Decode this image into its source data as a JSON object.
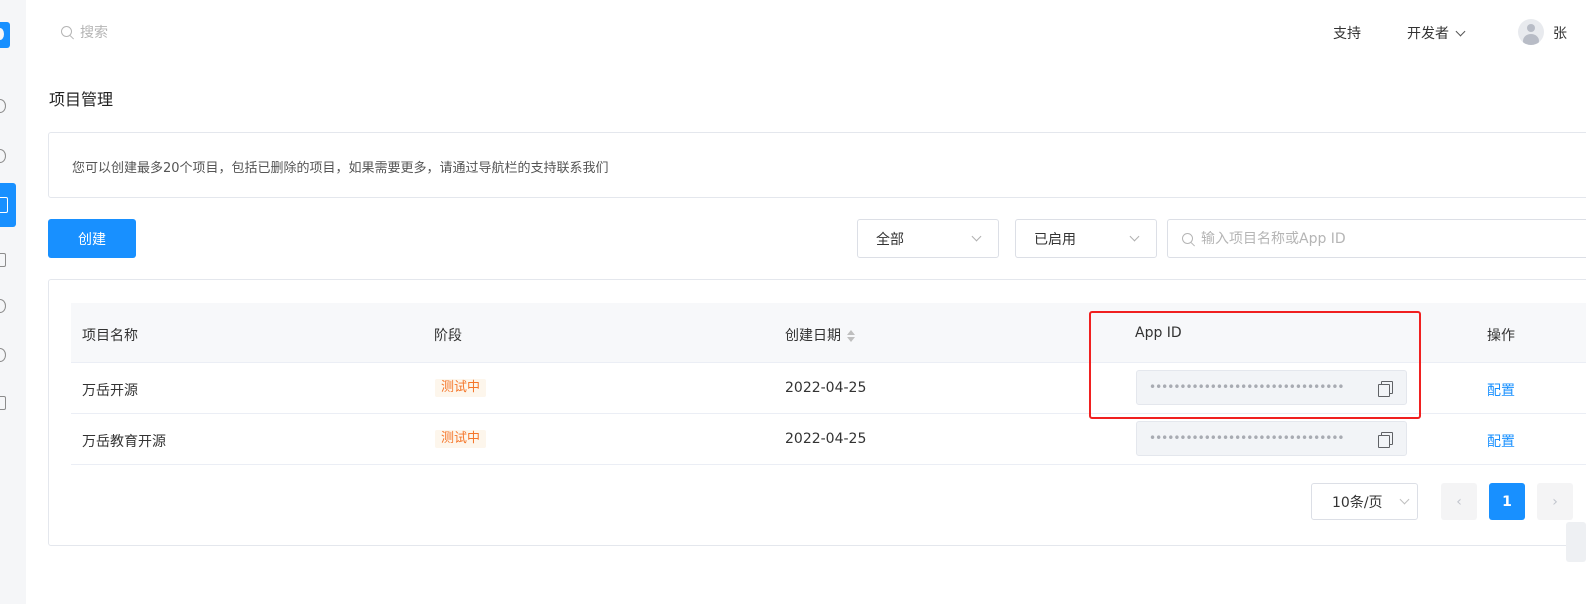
{
  "header": {
    "search_placeholder": "搜索",
    "support": "支持",
    "developer": "开发者",
    "user_name": "张"
  },
  "page": {
    "title": "项目管理",
    "notice": "您可以创建最多20个项目，包括已删除的项目，如果需要更多，请通过导航栏的支持联系我们"
  },
  "toolbar": {
    "create_label": "创建",
    "filter_stage": "全部",
    "filter_status": "已启用",
    "search_placeholder": "输入项目名称或App ID"
  },
  "table": {
    "columns": [
      "项目名称",
      "阶段",
      "创建日期",
      "App ID",
      "操作"
    ],
    "rows": [
      {
        "name": "万岳开源",
        "stage": "测试中",
        "date": "2022-04-25",
        "app_id": "••••••••••••••••••••••••••••••••",
        "action": "配置"
      },
      {
        "name": "万岳教育开源",
        "stage": "测试中",
        "date": "2022-04-25",
        "app_id": "••••••••••••••••••••••••••••••••",
        "action": "配置"
      }
    ]
  },
  "pagination": {
    "page_size": "10条/页",
    "prev": "‹",
    "current": "1",
    "next": "›"
  },
  "colors": {
    "primary": "#1890ff",
    "tag_text": "#f5762a",
    "tag_bg": "#fdf6ec",
    "highlight": "#f02020"
  }
}
